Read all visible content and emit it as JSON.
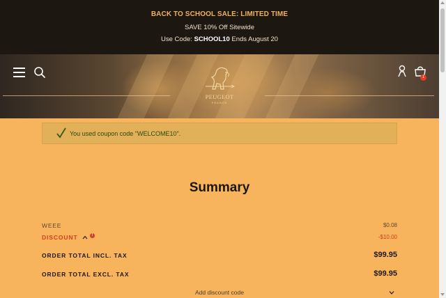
{
  "promo": {
    "title": "BACK TO SCHOOL SALE: LIMITED TIME",
    "line": "SAVE 10% Off Sitewide",
    "code_prefix": "Use Code: ",
    "code": "SCHOOL10",
    "code_suffix": " Ends August 20"
  },
  "header": {
    "logo_text": "PEUGEOT",
    "logo_subtext": "FRANCE",
    "cart_count": "1",
    "icons": [
      "menu-icon",
      "search-icon",
      "account-icon",
      "cart-icon"
    ]
  },
  "notice": {
    "message": "You used coupon code \"WELCOME10\"."
  },
  "summary": {
    "title": "Summary",
    "weee_label": "WEEE",
    "weee_value": "$0.08",
    "discount_label": "DISCOUNT",
    "discount_value": "-$10.00",
    "discount_info_badge": "!",
    "total_incl_label": "ORDER TOTAL INCL. TAX",
    "total_incl_value": "$99.95",
    "total_excl_label": "ORDER TOTAL EXCL. TAX",
    "total_excl_value": "$99.95",
    "add_discount_label": "Add discount code"
  },
  "colors": {
    "page_background": "#f7b45c",
    "promo_background": "#1d1712",
    "promo_accent": "#f0b15c",
    "notice_background": "#e1b058",
    "success_text": "#2b4a12",
    "discount_red": "#d2401f",
    "badge_red": "#e13b22"
  }
}
